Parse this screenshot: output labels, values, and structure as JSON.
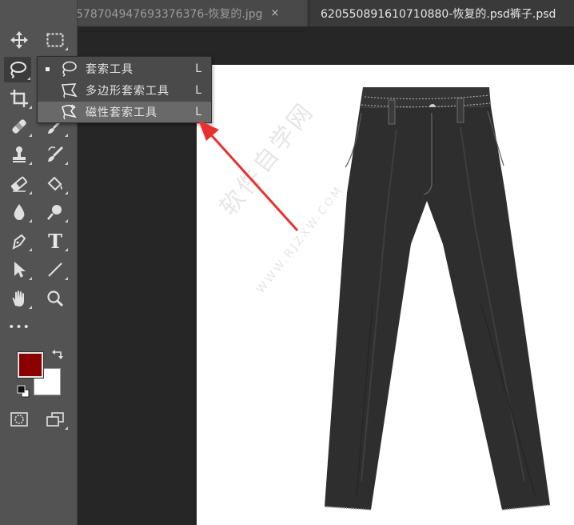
{
  "tabs": [
    {
      "label": "578704947693376376-恢复的.jpg",
      "close": "×"
    },
    {
      "label": "620550891610710880-恢复的.psd裤子.psd"
    }
  ],
  "toolbar": {
    "tools": [
      {
        "name": "move-tool",
        "icon": "move-icon"
      },
      {
        "name": "marquee-tool",
        "icon": "marquee-icon"
      },
      {
        "name": "lasso-tool",
        "icon": "lasso-icon"
      },
      {
        "name": "quick-select-tool",
        "icon": "quick-select-icon"
      },
      {
        "name": "crop-tool",
        "icon": "crop-icon"
      },
      {
        "name": "healing-brush-tool",
        "icon": "bandage-icon"
      },
      {
        "name": "brush-tool",
        "icon": "brush-icon"
      },
      {
        "name": "stamp-tool",
        "icon": "stamp-icon"
      },
      {
        "name": "history-brush-tool",
        "icon": "history-brush-icon"
      },
      {
        "name": "eraser-tool",
        "icon": "eraser-icon"
      },
      {
        "name": "paint-bucket-tool",
        "icon": "paint-bucket-icon"
      },
      {
        "name": "blur-tool",
        "icon": "drop-icon"
      },
      {
        "name": "dodge-tool",
        "icon": "dodge-icon"
      },
      {
        "name": "pen-tool",
        "icon": "pen-icon"
      },
      {
        "name": "type-tool",
        "icon": "type-icon"
      },
      {
        "name": "path-select-tool",
        "icon": "arrow-icon"
      },
      {
        "name": "line-tool",
        "icon": "line-icon"
      },
      {
        "name": "hand-tool",
        "icon": "hand-icon"
      },
      {
        "name": "zoom-tool",
        "icon": "zoom-icon"
      },
      {
        "name": "more-tools",
        "icon": "more-icon"
      }
    ],
    "type_glyph": "T",
    "more_glyph": "•••",
    "foreground_color": "#8b0000",
    "background_color": "#ffffff"
  },
  "flyout": {
    "items": [
      {
        "label": "套索工具",
        "shortcut": "L",
        "icon": "lasso-icon",
        "current": true
      },
      {
        "label": "多边形套索工具",
        "shortcut": "L",
        "icon": "polygon-lasso-icon"
      },
      {
        "label": "磁性套索工具",
        "shortcut": "L",
        "icon": "magnetic-lasso-icon",
        "highlighted": true
      }
    ]
  },
  "watermark": {
    "text": "软件自学网",
    "url": "WWW.RJZXW.COM"
  },
  "colors": {
    "arrow": "#e8312f",
    "pants": "#2e2e2e",
    "canvas": "#ffffff"
  }
}
